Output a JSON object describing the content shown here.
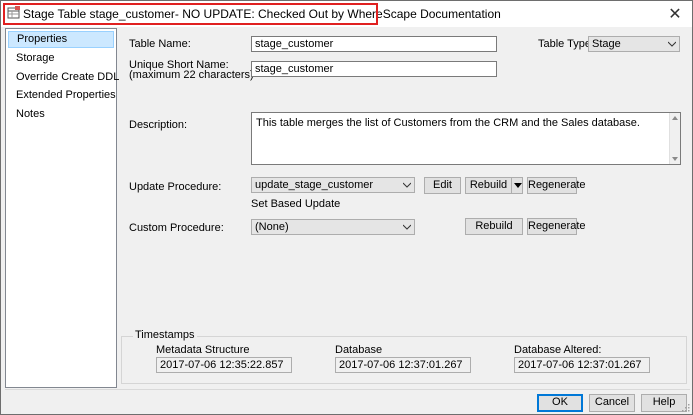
{
  "window": {
    "title": "Stage Table stage_customer- NO UPDATE: Checked Out by WhereScape Documentation",
    "close_symbol": "✕"
  },
  "sidebar": {
    "items": [
      {
        "label": "Properties",
        "selected": true
      },
      {
        "label": "Storage"
      },
      {
        "label": "Override Create DDL"
      },
      {
        "label": "Extended Properties"
      },
      {
        "label": "Notes"
      }
    ]
  },
  "properties": {
    "table_name_label": "Table Name:",
    "table_name_value": "stage_customer",
    "table_type_label": "Table Type:",
    "table_type_value": "Stage",
    "short_name_label_line1": "Unique Short Name:",
    "short_name_label_line2": "(maximum 22 characters)",
    "short_name_value": "stage_customer",
    "description_label": "Description:",
    "description_value": "This table merges the list of Customers from the CRM and the Sales database.",
    "update_procedure_label": "Update Procedure:",
    "update_procedure_value": "update_stage_customer",
    "edit_button": "Edit",
    "rebuild_button": "Rebuild",
    "regenerate_button": "Regenerate",
    "set_based_label": "Set Based Update",
    "custom_procedure_label": "Custom Procedure:",
    "custom_procedure_value": "(None)",
    "custom_rebuild_button": "Rebuild",
    "custom_regenerate_button": "Regenerate"
  },
  "timestamps": {
    "group_title": "Timestamps",
    "metadata_label": "Metadata Structure",
    "metadata_value": "2017-07-06 12:35:22.857",
    "database_label": "Database",
    "database_value": "2017-07-06 12:37:01.267",
    "database_altered_label": "Database Altered:",
    "database_altered_value": "2017-07-06 12:37:01.267"
  },
  "footer": {
    "ok_button": "OK",
    "cancel_button": "Cancel",
    "help_button": "Help"
  },
  "colors": {
    "title_highlight": "#e02020",
    "selected_item_bg": "#cce8ff",
    "dialog_bg": "#f0f0f0"
  },
  "icons": {
    "app": "table-icon",
    "close": "close-icon",
    "dropdown": "chevron-down-icon"
  }
}
